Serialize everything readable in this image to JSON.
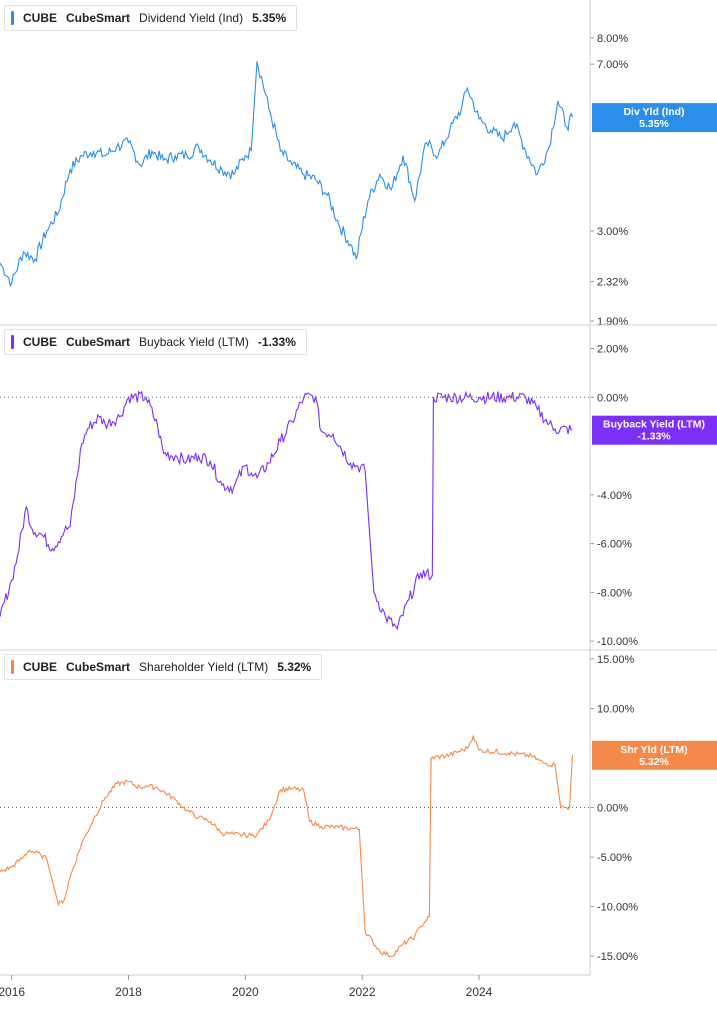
{
  "chart_data": [
    {
      "type": "line",
      "legend": {
        "ticker": "CUBE",
        "company": "CubeSmart",
        "metric": "Dividend Yield (Ind)",
        "value": "5.35%"
      },
      "badge": {
        "line1": "Div Yld (Ind)",
        "line2": "5.35%"
      },
      "color": "#2b8ee8",
      "y_scale": "log",
      "y_ticks": [
        8,
        7,
        3,
        2.32,
        1.9
      ],
      "y_tick_labels": [
        "8.00%",
        "7.00%",
        "3.00%",
        "2.32%",
        "1.90%"
      ],
      "ylim": [
        1.9,
        9.5
      ],
      "zero_line": false,
      "series": [
        {
          "x": [
            2015.8,
            2016.0,
            2016.2,
            2016.4,
            2016.6,
            2016.8,
            2017.0,
            2017.2,
            2017.4,
            2017.6,
            2017.8,
            2018.0,
            2018.2,
            2018.4,
            2018.6,
            2018.8,
            2019.0,
            2019.2,
            2019.4,
            2019.6,
            2019.8,
            2020.0,
            2020.1,
            2020.2,
            2020.4,
            2020.6,
            2020.8,
            2021.0,
            2021.2,
            2021.4,
            2021.6,
            2021.8,
            2021.9,
            2022.1,
            2022.3,
            2022.5,
            2022.7,
            2022.9,
            2023.1,
            2023.3,
            2023.5,
            2023.7,
            2023.8,
            2024.0,
            2024.2,
            2024.4,
            2024.6,
            2024.8,
            2025.0,
            2025.2,
            2025.35,
            2025.5,
            2025.6
          ],
          "values": [
            2.55,
            2.3,
            2.7,
            2.6,
            3.0,
            3.3,
            4.1,
            4.4,
            4.5,
            4.4,
            4.6,
            4.7,
            4.2,
            4.5,
            4.3,
            4.4,
            4.4,
            4.6,
            4.3,
            4.1,
            4.0,
            4.4,
            4.5,
            7.1,
            5.6,
            4.5,
            4.2,
            4.0,
            3.9,
            3.6,
            3.1,
            2.8,
            2.6,
            3.5,
            4.0,
            3.7,
            4.4,
            3.5,
            4.7,
            4.4,
            5.0,
            5.6,
            6.2,
            5.3,
            5.0,
            4.8,
            5.2,
            4.5,
            4.0,
            4.6,
            5.8,
            5.1,
            5.35
          ]
        }
      ]
    },
    {
      "type": "line",
      "legend": {
        "ticker": "CUBE",
        "company": "CubeSmart",
        "metric": "Buyback Yield (LTM)",
        "value": "-1.33%"
      },
      "badge": {
        "line1": "Buyback Yield (LTM)",
        "line2": "-1.33%"
      },
      "color": "#7b2ff7",
      "y_scale": "linear",
      "y_ticks": [
        2,
        0,
        -4,
        -6,
        -8,
        -10
      ],
      "y_tick_labels": [
        "2.00%",
        "0.00%",
        "-4.00%",
        "-6.00%",
        "-8.00%",
        "-10.00%"
      ],
      "ylim": [
        -10.2,
        2.8
      ],
      "zero_line": true,
      "series": [
        {
          "x": [
            2015.8,
            2016.0,
            2016.1,
            2016.25,
            2016.35,
            2016.5,
            2016.7,
            2016.9,
            2017.0,
            2017.2,
            2017.3,
            2017.5,
            2017.6,
            2017.85,
            2018.0,
            2018.3,
            2018.5,
            2018.6,
            2018.8,
            2019.0,
            2019.2,
            2019.4,
            2019.6,
            2019.8,
            2020.0,
            2020.1,
            2020.2,
            2020.4,
            2020.6,
            2020.8,
            2021.0,
            2021.2,
            2021.3,
            2021.5,
            2021.8,
            2021.9,
            2022.05,
            2022.2,
            2022.4,
            2022.6,
            2022.8,
            2023.0,
            2023.2,
            2023.22,
            2023.5,
            2024.0,
            2024.5,
            2024.8,
            2025.0,
            2025.2,
            2025.3,
            2025.6
          ],
          "values": [
            -9.0,
            -7.5,
            -6.5,
            -4.5,
            -5.4,
            -5.6,
            -6.2,
            -5.5,
            -5.3,
            -1.9,
            -1.3,
            -0.8,
            -1.1,
            -0.8,
            0.0,
            0.0,
            -1.2,
            -2.3,
            -2.4,
            -2.6,
            -2.4,
            -2.6,
            -3.6,
            -3.7,
            -2.8,
            -3.1,
            -3.3,
            -2.7,
            -1.8,
            -1.0,
            0.0,
            0.0,
            -1.4,
            -1.5,
            -2.7,
            -2.8,
            -3.0,
            -8.0,
            -9.0,
            -9.5,
            -8.3,
            -7.2,
            -7.3,
            0.0,
            0.0,
            0.0,
            0.0,
            0.0,
            -0.5,
            -1.1,
            -1.3,
            -1.33
          ]
        }
      ]
    },
    {
      "type": "line",
      "legend": {
        "ticker": "CUBE",
        "company": "CubeSmart",
        "metric": "Shareholder Yield (LTM)",
        "value": "5.32%"
      },
      "badge": {
        "line1": "Shr Yld (LTM)",
        "line2": "5.32%"
      },
      "color": "#f5894a",
      "y_scale": "linear",
      "y_ticks": [
        15,
        10,
        0,
        -5,
        -10,
        -15
      ],
      "y_tick_labels": [
        "15.00%",
        "10.00%",
        "0.00%",
        "-5.00%",
        "-10.00%",
        "-15.00%"
      ],
      "ylim": [
        -16.5,
        15.5
      ],
      "zero_line": true,
      "series": [
        {
          "x": [
            2015.8,
            2016.0,
            2016.2,
            2016.3,
            2016.5,
            2016.6,
            2016.8,
            2016.9,
            2017.0,
            2017.2,
            2017.4,
            2017.6,
            2017.8,
            2018.0,
            2018.2,
            2018.3,
            2018.5,
            2018.8,
            2019.0,
            2019.2,
            2019.4,
            2019.6,
            2019.8,
            2020.0,
            2020.1,
            2020.2,
            2020.4,
            2020.6,
            2020.8,
            2021.0,
            2021.1,
            2021.3,
            2021.6,
            2021.8,
            2021.95,
            2022.05,
            2022.3,
            2022.5,
            2022.7,
            2022.9,
            2023.0,
            2023.15,
            2023.18,
            2023.5,
            2023.8,
            2023.9,
            2024.0,
            2024.5,
            2024.9,
            2025.1,
            2025.3,
            2025.4,
            2025.55,
            2025.6
          ],
          "values": [
            -6.5,
            -6.0,
            -5.0,
            -4.3,
            -4.8,
            -5.2,
            -9.8,
            -9.3,
            -7.0,
            -3.6,
            -1.2,
            1.0,
            2.4,
            2.6,
            2.0,
            2.2,
            2.0,
            0.8,
            -0.3,
            -1.0,
            -1.4,
            -2.6,
            -2.7,
            -2.8,
            -2.8,
            -2.7,
            -1.3,
            1.8,
            1.9,
            1.7,
            -1.4,
            -1.9,
            -2.0,
            -2.1,
            -2.2,
            -12.5,
            -14.5,
            -15.0,
            -13.8,
            -13.0,
            -12.0,
            -11.0,
            5.0,
            5.3,
            6.0,
            7.2,
            5.8,
            5.5,
            5.2,
            4.5,
            4.3,
            0.0,
            0.0,
            5.32
          ]
        }
      ]
    }
  ],
  "x_axis": {
    "range": [
      2015.8,
      2025.9
    ],
    "ticks": [
      2016,
      2018,
      2020,
      2022,
      2024
    ],
    "tick_labels": [
      "2016",
      "2018",
      "2020",
      "2022",
      "2024"
    ]
  }
}
